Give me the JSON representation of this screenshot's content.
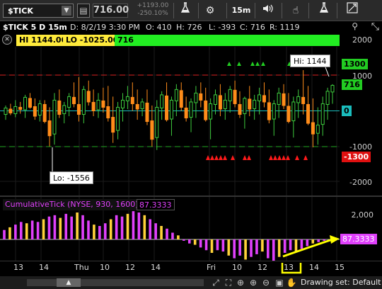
{
  "toolbar": {
    "symbol": "$TICK",
    "last_price": "716.00",
    "net_change": "+1193.00",
    "net_change_pct": "-250.10%",
    "timeframe": "15m",
    "icons": [
      "chart-type-icon",
      "flask-icon",
      "gear-icon",
      "timeframe-label",
      "speaker-icon",
      "hand-icon",
      "flask-icon",
      "drawing-icon"
    ]
  },
  "info": {
    "title": "$TICK 5 D 15m",
    "date": "D: 8/2/19 3:30 PM",
    "open": "O: 410",
    "high": "H: 726",
    "low": "L: -393",
    "close": "C: 716",
    "range": "R: 1119"
  },
  "study_labels": {
    "hi": "HI 1144.00",
    "lo": "LO -1025.00",
    "tick": "716"
  },
  "price_axis": {
    "labels": [
      "2000",
      "1000",
      "-1000",
      "-2000"
    ],
    "tags": {
      "level_1300": "1300",
      "current": "716",
      "zero": "0",
      "level_neg_1300": "-1300"
    }
  },
  "callouts": {
    "hi": "Hi: 1144",
    "lo": "Lo: -1556"
  },
  "lower_pane": {
    "label": "CumulativeTick (NYSE, 930, 1600)",
    "value": "87.3333",
    "axis_label": "2,000",
    "tag": "87.3333"
  },
  "x_axis": [
    "13",
    "14",
    "Thu",
    "10",
    "12",
    "14",
    "Fri",
    "10",
    "12",
    "13",
    "14",
    "15"
  ],
  "bottom": {
    "drawing_set": "Drawing set: Default"
  },
  "colors": {
    "up_candle": "#3ecb3e",
    "down_candle": "#ff8c1a",
    "cum_positive": "#e040fb",
    "cum_negative": "#ffd23a",
    "upper_dashed": "#d22",
    "lower_dashed": "#2a2",
    "zero_line": "#1abcbc",
    "tick_label_bg": "#22ee22",
    "hi_lo_bg": "#ffeb3b",
    "neg_tag": "#e01010",
    "annotation": "#ffff00"
  },
  "chart_data": [
    {
      "type": "candlestick",
      "title": "$TICK 5 D 15m",
      "ylim": [
        -2000,
        2000
      ],
      "x_ticks": [
        "13",
        "14",
        "Thu",
        "10",
        "12",
        "14",
        "Fri",
        "10",
        "12",
        "13",
        "14",
        "15"
      ],
      "reference_lines": [
        {
          "value": 1000,
          "style": "dashed",
          "color": "red"
        },
        {
          "value": -1000,
          "style": "dashed",
          "color": "green"
        },
        {
          "value": 0,
          "color": "cyan"
        }
      ],
      "series": [
        {
          "values": [
            [
              -100,
              150,
              -250,
              80
            ],
            [
              50,
              200,
              -120,
              -60
            ],
            [
              -80,
              300,
              -180,
              120
            ],
            [
              100,
              250,
              -80,
              40
            ],
            [
              30,
              450,
              -200,
              380
            ],
            [
              350,
              500,
              60,
              100
            ],
            [
              120,
              350,
              -250,
              -150
            ],
            [
              -120,
              300,
              -300,
              200
            ],
            [
              180,
              300,
              -350,
              -300
            ],
            [
              -280,
              100,
              -1000,
              -700
            ],
            [
              -650,
              500,
              -950,
              300
            ],
            [
              280,
              600,
              -200,
              -100
            ],
            [
              -80,
              250,
              -350,
              150
            ],
            [
              100,
              500,
              -150,
              400
            ],
            [
              380,
              800,
              100,
              200
            ],
            [
              180,
              950,
              -300,
              -100
            ],
            [
              -100,
              700,
              -350,
              600
            ],
            [
              550,
              850,
              150,
              250
            ],
            [
              240,
              600,
              -150,
              0
            ],
            [
              30,
              500,
              -200,
              300
            ],
            [
              280,
              650,
              -50,
              100
            ],
            [
              120,
              700,
              -300,
              -200
            ],
            [
              -180,
              400,
              -900,
              -600
            ],
            [
              -550,
              250,
              -800,
              100
            ],
            [
              80,
              500,
              -300,
              300
            ],
            [
              280,
              700,
              50,
              400
            ],
            [
              380,
              800,
              0,
              200
            ],
            [
              180,
              600,
              -250,
              50
            ],
            [
              60,
              350,
              -150,
              250
            ],
            [
              220,
              600,
              -400,
              -300
            ],
            [
              -280,
              150,
              -1000,
              -800
            ],
            [
              -750,
              300,
              -1100,
              100
            ],
            [
              80,
              550,
              -250,
              450
            ],
            [
              420,
              800,
              -300,
              -250
            ],
            [
              -230,
              400,
              -700,
              300
            ],
            [
              280,
              750,
              -150,
              600
            ],
            [
              570,
              800,
              0,
              100
            ],
            [
              80,
              400,
              -300,
              -200
            ],
            [
              -180,
              350,
              -600,
              250
            ],
            [
              230,
              700,
              -200,
              500
            ],
            [
              480,
              800,
              100,
              300
            ],
            [
              280,
              650,
              -300,
              -250
            ],
            [
              -230,
              350,
              -800,
              200
            ],
            [
              180,
              600,
              -100,
              450
            ],
            [
              430,
              750,
              -150,
              50
            ],
            [
              60,
              500,
              -250,
              300
            ],
            [
              280,
              700,
              -50,
              600
            ],
            [
              580,
              850,
              100,
              200
            ],
            [
              180,
              550,
              -200,
              -100
            ],
            [
              -80,
              400,
              -500,
              350
            ],
            [
              330,
              700,
              -150,
              50
            ],
            [
              60,
              450,
              -250,
              300
            ],
            [
              280,
              650,
              -100,
              450
            ],
            [
              430,
              800,
              100,
              250
            ],
            [
              230,
              600,
              -350,
              -250
            ],
            [
              -230,
              300,
              -700,
              200
            ],
            [
              180,
              650,
              -200,
              500
            ],
            [
              480,
              750,
              50,
              150
            ],
            [
              130,
              500,
              -350,
              -300
            ],
            [
              -280,
              400,
              -750,
              250
            ],
            [
              230,
              600,
              -200,
              400
            ],
            [
              380,
              1144,
              -100,
              200
            ],
            [
              180,
              700,
              -400,
              -350
            ],
            [
              -330,
              350,
              -1025,
              -650
            ],
            [
              -630,
              100,
              -950,
              -400
            ],
            [
              -380,
              400,
              -700,
              200
            ],
            [
              180,
              650,
              -250,
              550
            ],
            [
              530,
              750,
              200,
              716
            ]
          ]
        }
      ]
    },
    {
      "type": "bar",
      "title": "CumulativeTick (NYSE, 930, 1600)",
      "ylim": [
        -2500,
        2500
      ],
      "series": [
        {
          "values": [
            700,
            900,
            1100,
            1300,
            1200,
            1400,
            1300,
            1500,
            1700,
            1800,
            1600,
            1900,
            1700,
            2000,
            1800,
            1400,
            1100,
            1000,
            1200,
            1500,
            1800,
            1700,
            1900,
            2100,
            2000,
            1800,
            1500,
            1200,
            1000,
            800,
            500,
            300,
            -100,
            -300,
            -400,
            -600,
            -800,
            -1000,
            -800,
            -900,
            -1200,
            -1400,
            -1200,
            -1500,
            -1300,
            -1100,
            -900,
            -1400,
            -1600,
            -1300,
            -1000,
            -800,
            -900,
            -700,
            -500,
            -300,
            -200,
            -100,
            0,
            87.3333
          ]
        }
      ]
    }
  ]
}
